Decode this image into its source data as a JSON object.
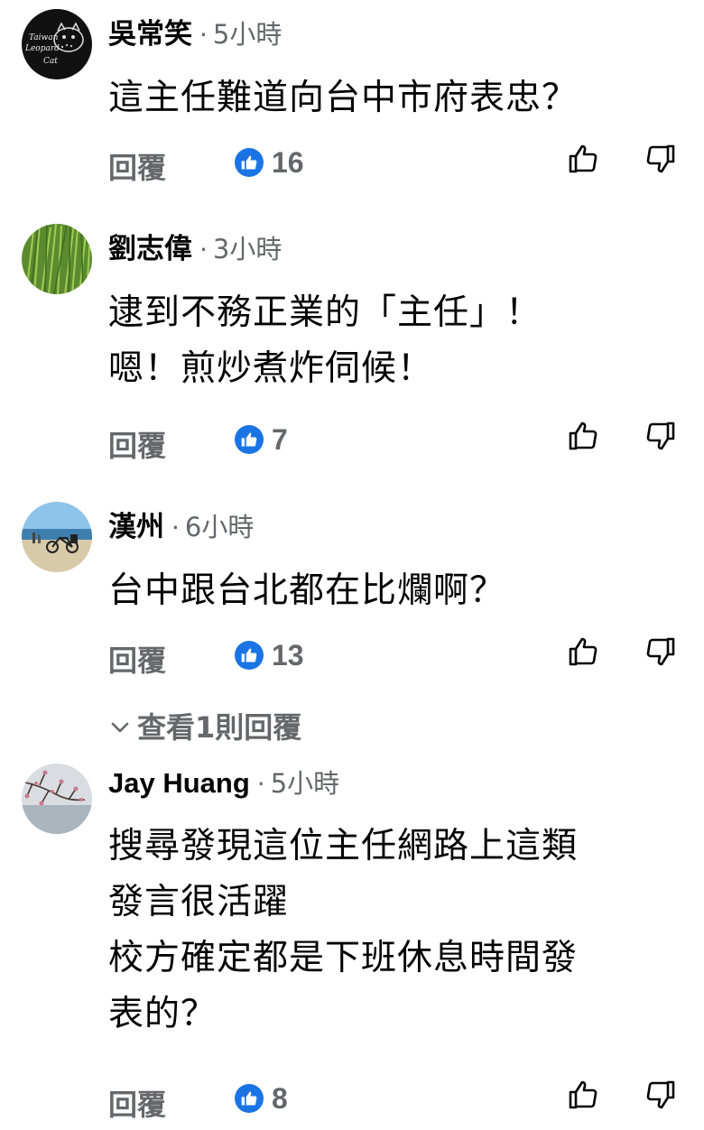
{
  "comments": [
    {
      "author": "吳常笑",
      "separator": "·",
      "time": "5小時",
      "text": "這主任難道向台中市府表忠？",
      "reply_label": "回覆",
      "likes": "16",
      "avatar_text": [
        "Taiwan",
        "Leopard",
        "Cat"
      ]
    },
    {
      "author": "劉志偉",
      "separator": "·",
      "time": "3小時",
      "text": "逮到不務正業的「主任」！\n嗯！煎炒煮炸伺候！",
      "reply_label": "回覆",
      "likes": "7"
    },
    {
      "author": "漢州",
      "separator": "·",
      "time": "6小時",
      "text": "台中跟台北都在比爛啊？",
      "reply_label": "回覆",
      "likes": "13",
      "view_replies_label": "查看1則回覆"
    },
    {
      "author": "Jay Huang",
      "separator": "·",
      "time": "5小時",
      "text": "搜尋發現這位主任網路上這類\n發言很活躍\n校方確定都是下班休息時間發\n表的？",
      "reply_label": "回覆",
      "likes": "8"
    }
  ],
  "colors": {
    "like_badge": "#1b74e4",
    "meta_gray": "#65676b",
    "text": "#050505"
  },
  "icons": [
    "thumbs-up-icon",
    "thumbs-down-icon",
    "chevron-down-icon",
    "like-badge-icon"
  ]
}
